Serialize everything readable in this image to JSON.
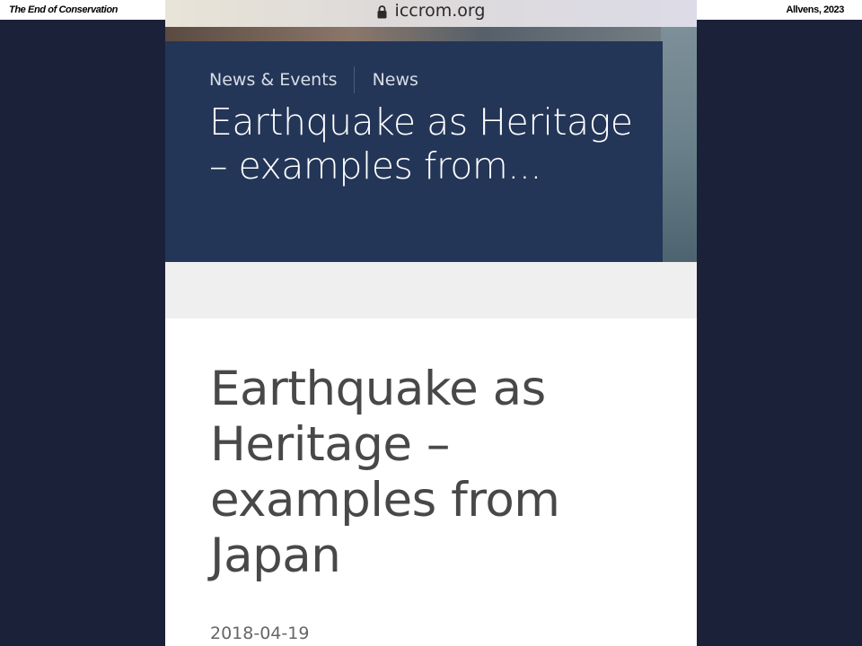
{
  "slide": {
    "header_left": "The End of Conservation",
    "header_right": "Allvens, 2023"
  },
  "browser": {
    "url": "iccrom.org",
    "lock_icon": "lock-icon"
  },
  "hero": {
    "breadcrumb": [
      "News & Events",
      "News"
    ],
    "title": "Earthquake as Heritage – examples from..."
  },
  "article": {
    "title": "Earthquake as Heritage – examples from Japan",
    "date": "2018-04-19"
  },
  "colors": {
    "slide_background": "#1b2139",
    "hero_panel": "#243657",
    "title_text": "#484848"
  }
}
